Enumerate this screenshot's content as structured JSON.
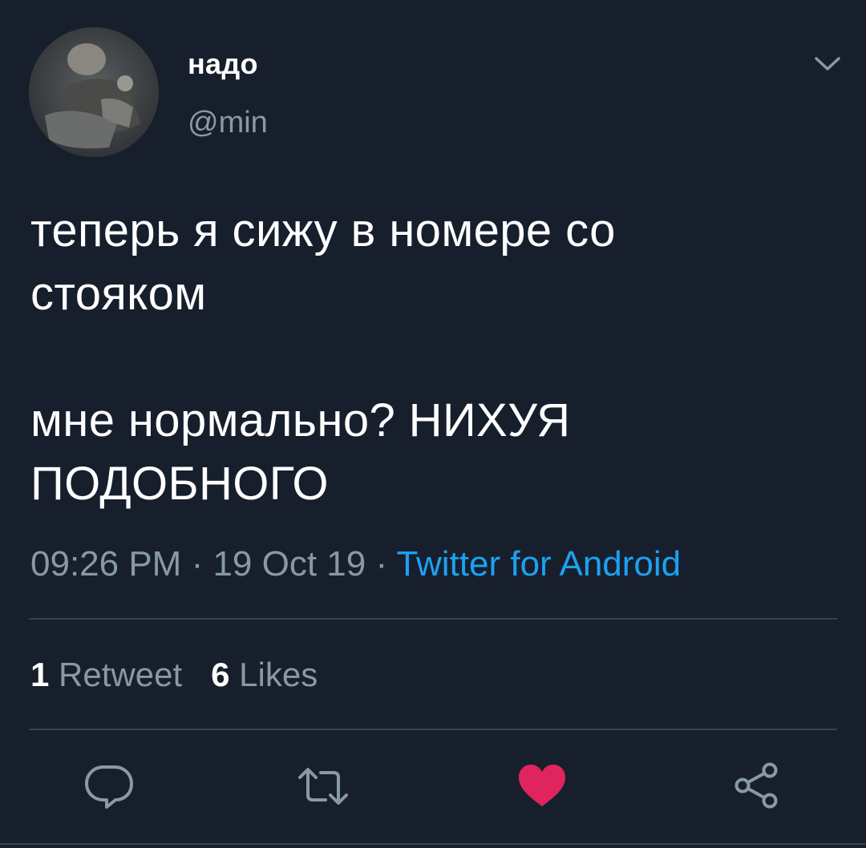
{
  "tweet": {
    "author": {
      "display_name": "надо",
      "handle": "@min"
    },
    "text": "теперь я сижу в номере со\nстояком\n\nмне нормально? НИХУЯ\nПОДОБНОГО",
    "time": "09:26 PM",
    "date": "19 Oct 19",
    "separator": " · ",
    "source": "Twitter for Android",
    "retweet_count": "1",
    "retweet_label": "Retweet",
    "like_count": "6",
    "like_label": "Likes"
  },
  "actions": [
    {
      "icon": "reply-icon"
    },
    {
      "icon": "retweet-icon"
    },
    {
      "icon": "heart-icon",
      "active": true
    },
    {
      "icon": "share-icon"
    }
  ],
  "colors": {
    "background": "#171f2d",
    "primary_text": "#ffffff",
    "secondary_text": "#8899a6",
    "link": "#1da1f2",
    "divider": "#38444d",
    "like_active": "#e0245e"
  }
}
